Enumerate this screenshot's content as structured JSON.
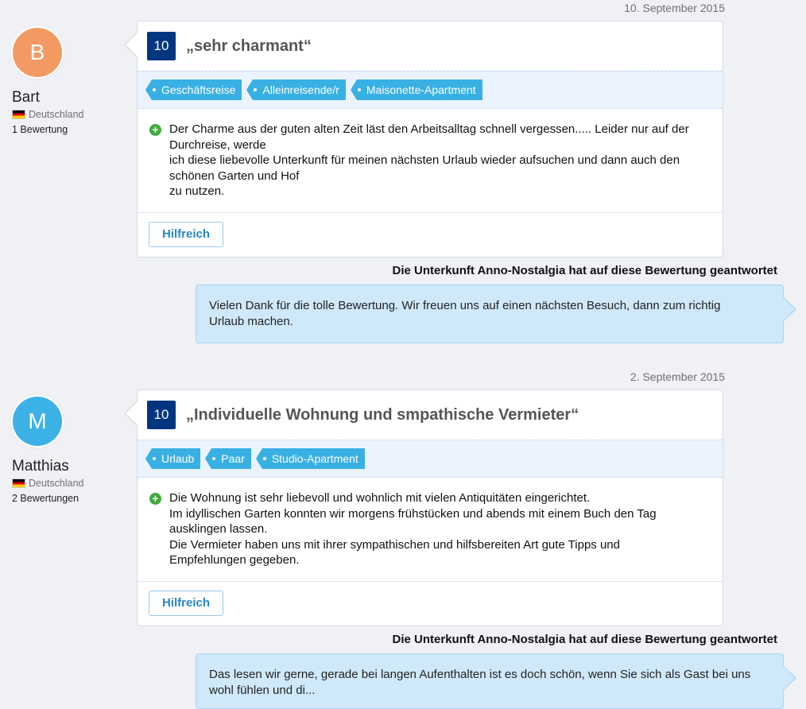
{
  "reviews": [
    {
      "date": "10. September 2015",
      "initial": "B",
      "name": "Bart",
      "country": "Deutschland",
      "count": "1 Bewertung",
      "score": "10",
      "title": "„sehr charmant“",
      "tags": [
        "Geschäftsreise",
        "Alleinreisende/r",
        "Maisonette-Apartment"
      ],
      "positive_lines": [
        "Der Charme aus der guten alten Zeit läst den Arbeitsalltag schnell vergessen..... Leider nur auf der",
        "Durchreise, werde",
        "ich diese liebevolle Unterkunft für meinen nächsten Urlaub wieder aufsuchen und dann  auch den",
        "schönen Garten und Hof",
        "zu nutzen."
      ],
      "helpful_label": "Hilfreich",
      "response_label": "Die Unterkunft Anno-Nostalgia hat auf diese Bewertung geantwortet",
      "response_lines": [
        "Vielen Dank für die tolle Bewertung. Wir freuen uns auf einen nächsten Besuch, dann zum richtig",
        "Urlaub machen."
      ]
    },
    {
      "date": "2. September 2015",
      "initial": "M",
      "name": "Matthias",
      "country": "Deutschland",
      "count": "2 Bewertungen",
      "score": "10",
      "title": "„Individuelle Wohnung und smpathische Vermieter“",
      "tags": [
        "Urlaub",
        "Paar",
        "Studio-Apartment"
      ],
      "positive_lines": [
        "Die Wohnung ist sehr liebevoll und wohnlich mit vielen Antiquitäten eingerichtet.",
        "Im idyllischen Garten konnten wir morgens frühstücken und abends mit einem Buch den Tag",
        "ausklingen lassen.",
        "Die Vermieter haben uns mit ihrer sympathischen und hilfsbereiten Art gute Tipps und",
        "Empfehlungen gegeben."
      ],
      "helpful_label": "Hilfreich",
      "response_label": "Die Unterkunft Anno-Nostalgia hat auf diese Bewertung geantwortet",
      "response_lines": [
        "Das lesen wir gerne, gerade bei langen Aufenthalten ist es doch schön, wenn Sie sich als Gast bei uns",
        "wohl fühlen und di..."
      ]
    }
  ],
  "colors": {
    "score_bg": "#003580",
    "tag_bg": "#39b0e4",
    "positive_icon": "#3fab3b",
    "response_bg": "#cfe9fb"
  }
}
